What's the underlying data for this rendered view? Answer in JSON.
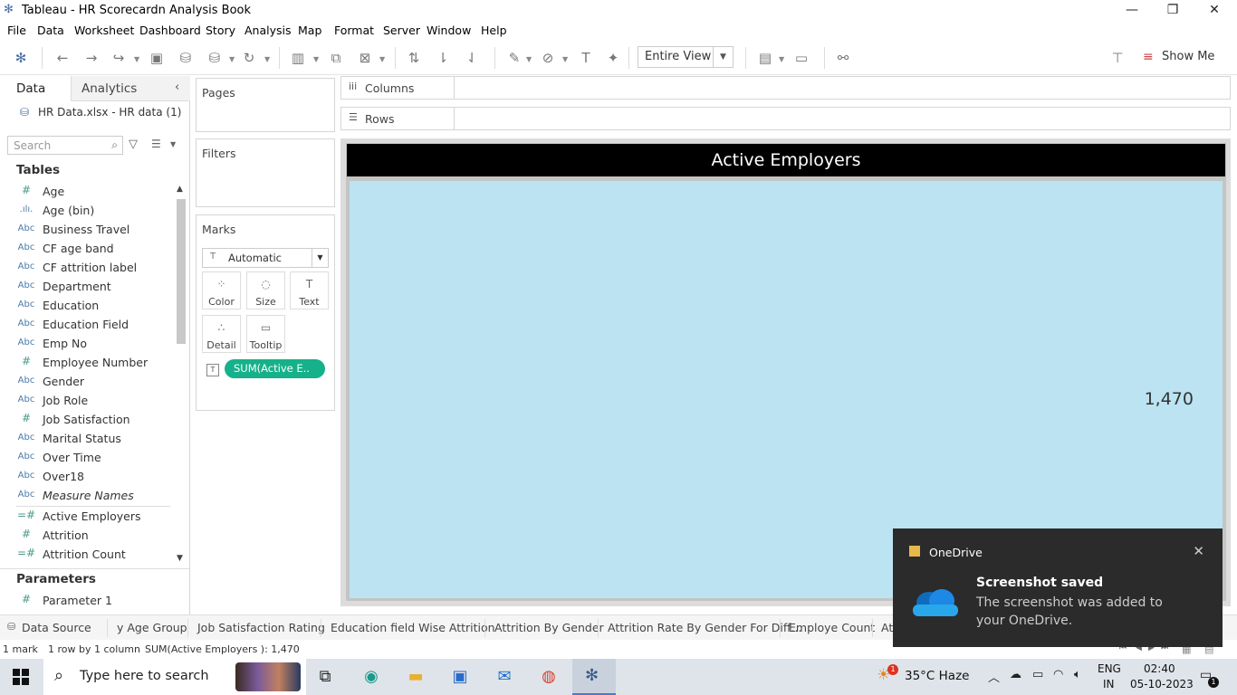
{
  "window": {
    "title": "Tableau - HR Scorecardn Analysis Book"
  },
  "menu": [
    "File",
    "Data",
    "Worksheet",
    "Dashboard",
    "Story",
    "Analysis",
    "Map",
    "Format",
    "Server",
    "Window",
    "Help"
  ],
  "toolbar": {
    "fit": "Entire View",
    "show_me": "Show Me"
  },
  "data_pane": {
    "tabs": [
      "Data",
      "Analytics"
    ],
    "source": "HR Data.xlsx - HR data (1)",
    "search_placeholder": "Search",
    "tables_header": "Tables",
    "fields": [
      {
        "icon": "#",
        "name": "Age"
      },
      {
        "icon": ".ılı.",
        "name": "Age (bin)"
      },
      {
        "icon": "Abc",
        "name": "Business Travel"
      },
      {
        "icon": "Abc",
        "name": "CF age band"
      },
      {
        "icon": "Abc",
        "name": "CF attrition label"
      },
      {
        "icon": "Abc",
        "name": "Department"
      },
      {
        "icon": "Abc",
        "name": "Education"
      },
      {
        "icon": "Abc",
        "name": "Education Field"
      },
      {
        "icon": "Abc",
        "name": "Emp No"
      },
      {
        "icon": "#",
        "name": "Employee Number"
      },
      {
        "icon": "Abc",
        "name": "Gender"
      },
      {
        "icon": "Abc",
        "name": "Job Role"
      },
      {
        "icon": "#",
        "name": "Job Satisfaction"
      },
      {
        "icon": "Abc",
        "name": "Marital Status"
      },
      {
        "icon": "Abc",
        "name": "Over Time"
      },
      {
        "icon": "Abc",
        "name": "Over18"
      },
      {
        "icon": "Abc",
        "name": "Measure Names"
      },
      {
        "icon": "=#",
        "name": "Active Employers"
      },
      {
        "icon": "#",
        "name": "Attrition"
      },
      {
        "icon": "=#",
        "name": "Attrition Count"
      }
    ],
    "parameters_header": "Parameters",
    "parameters": [
      {
        "icon": "#",
        "name": "Parameter 1"
      }
    ]
  },
  "cards": {
    "pages": "Pages",
    "filters": "Filters",
    "marks": "Marks",
    "mark_type": "Automatic",
    "mark_buttons": [
      "Color",
      "Size",
      "Text",
      "Detail",
      "Tooltip"
    ],
    "pill": "SUM(Active E.."
  },
  "shelves": {
    "columns": "Columns",
    "rows": "Rows"
  },
  "viz": {
    "title": "Active Employers",
    "value": "1,470"
  },
  "sheet_tabs": [
    "Data Source",
    "y Age Group",
    "Job Satisfaction Rating",
    "Education field Wise Attrition",
    "Attrition By Gender",
    "Attrition Rate By Gender For Diff...",
    "Employe Count",
    "Att"
  ],
  "status": {
    "marks": "1 mark",
    "dims": "1 row by 1 column",
    "sum": "SUM(Active Employers ): 1,470"
  },
  "taskbar": {
    "search": "Type here to search",
    "weather": "35°C  Haze",
    "lang1": "ENG",
    "lang2": "IN",
    "time": "02:40",
    "date": "05-10-2023",
    "notif": "1",
    "weather_badge": "1"
  },
  "toast": {
    "app": "OneDrive",
    "heading": "Screenshot saved",
    "body": "The screenshot was added to your OneDrive."
  }
}
